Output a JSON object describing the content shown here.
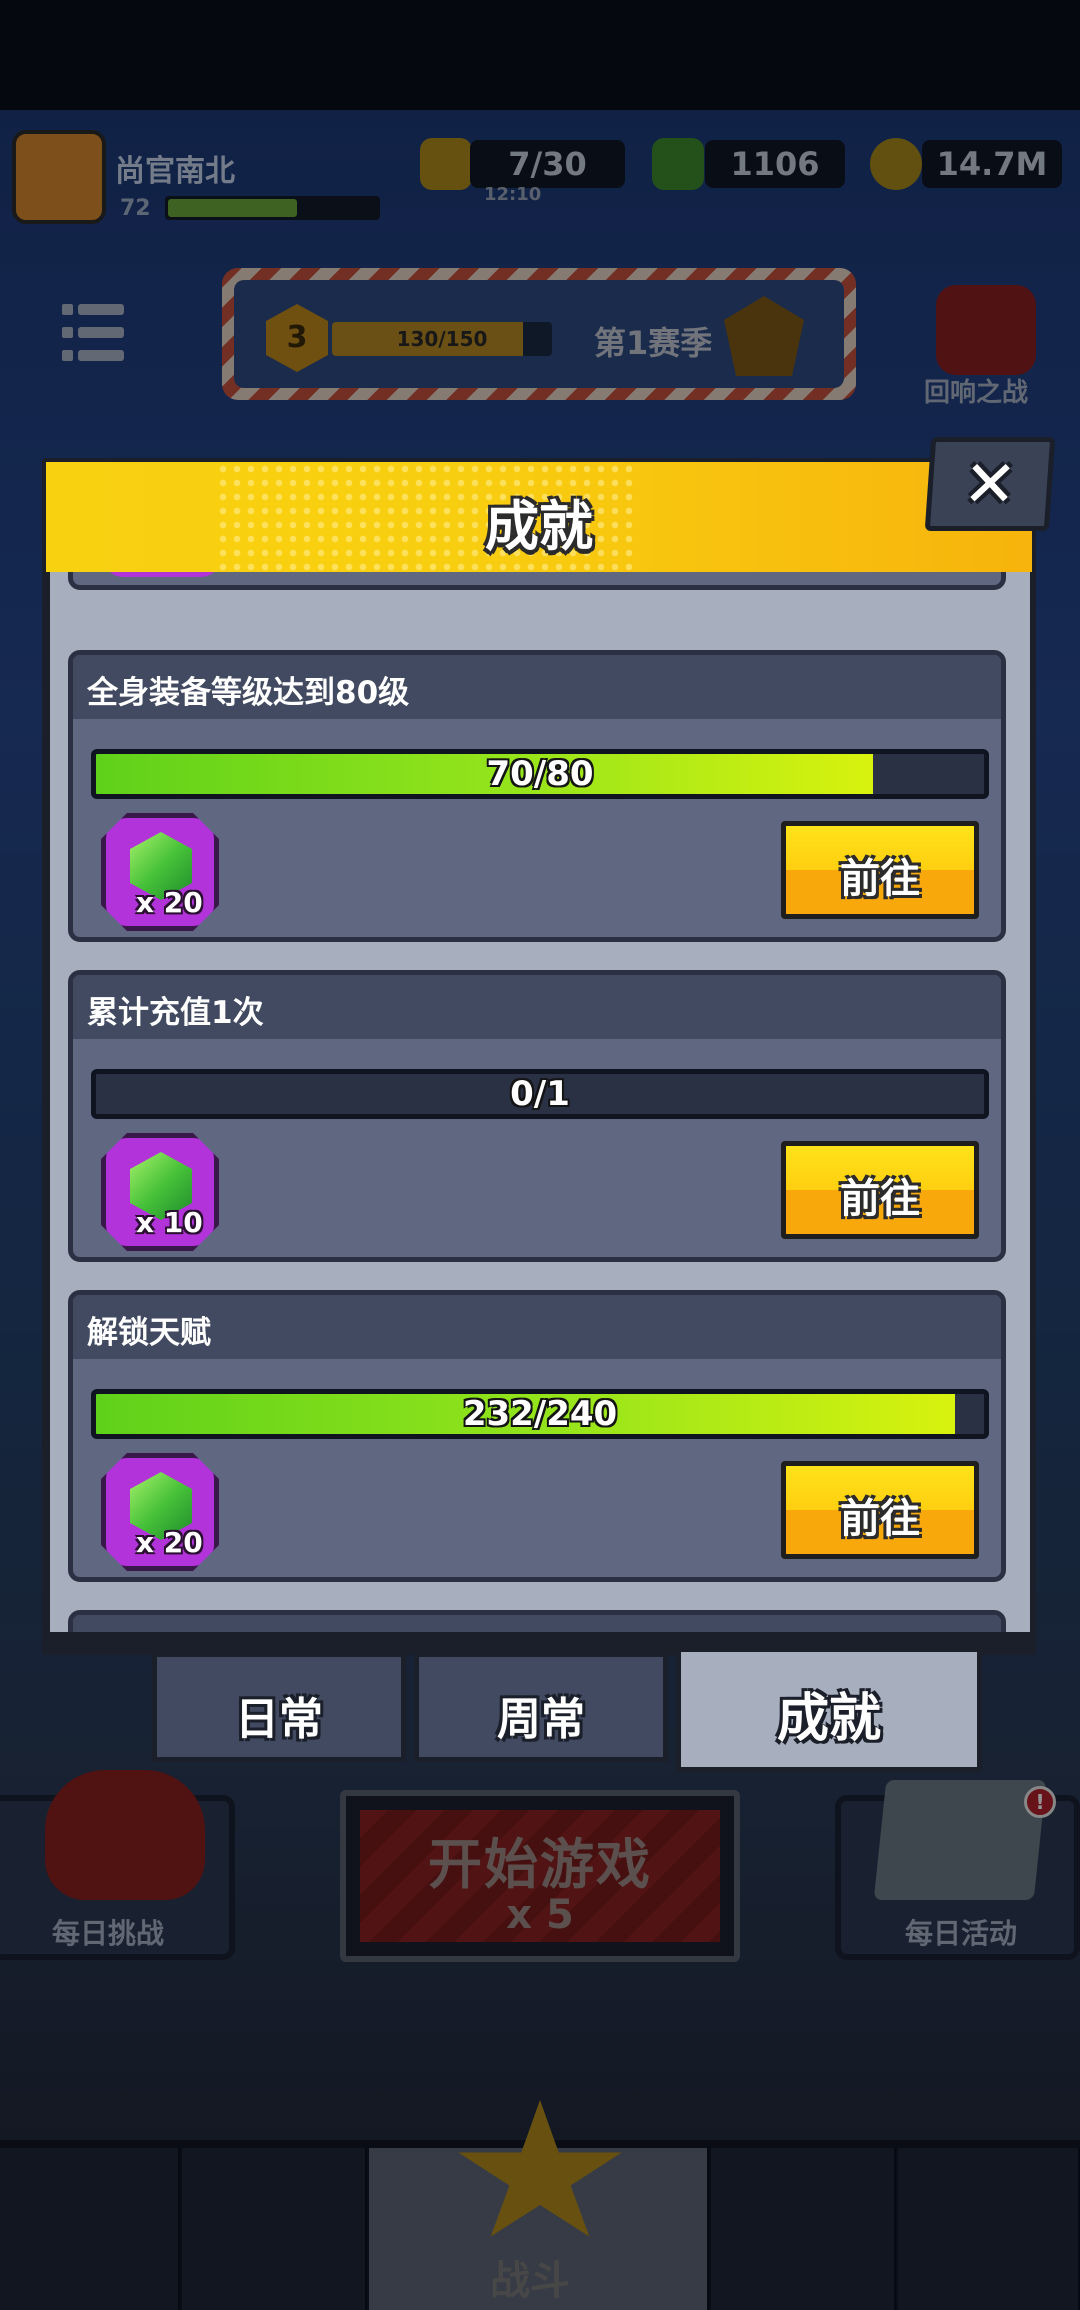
{
  "player": {
    "name": "尚官南北",
    "level": "72",
    "xp_fraction": 0.6
  },
  "resources": {
    "energy": "7/30",
    "energy_timer": "12:10",
    "gems": "1106",
    "coins": "14.7M"
  },
  "season": {
    "level": "3",
    "progress": "130/150",
    "progress_fraction": 0.867,
    "label": "第1赛季"
  },
  "boss_event_label": "回响之战",
  "main_buttons": {
    "daily_challenge": "每日挑战",
    "start_game": "开始游戏",
    "start_cost": "x 5",
    "daily_event": "每日活动",
    "battle": "战斗"
  },
  "dialog": {
    "title": "成就",
    "close_glyph": "✕",
    "achievements": [
      {
        "title": "全身装备等级达到80级",
        "progress": "70/80",
        "fraction": 0.875,
        "reward_count": "x 20",
        "button": "前往"
      },
      {
        "title": "累计充值1次",
        "progress": "0/1",
        "fraction": 0.0,
        "reward_count": "x 10",
        "button": "前往"
      },
      {
        "title": "解锁天赋",
        "progress": "232/240",
        "fraction": 0.967,
        "reward_count": "x 20",
        "button": "前往"
      }
    ],
    "tabs": [
      {
        "label": "日常",
        "active": false
      },
      {
        "label": "周常",
        "active": false
      },
      {
        "label": "成就",
        "active": true
      }
    ]
  },
  "colors": {
    "header_yellow": "#f8d111",
    "progress_green": "#97e51b",
    "reward_purple": "#b233d9",
    "button_yellow": "#ffcf10"
  }
}
